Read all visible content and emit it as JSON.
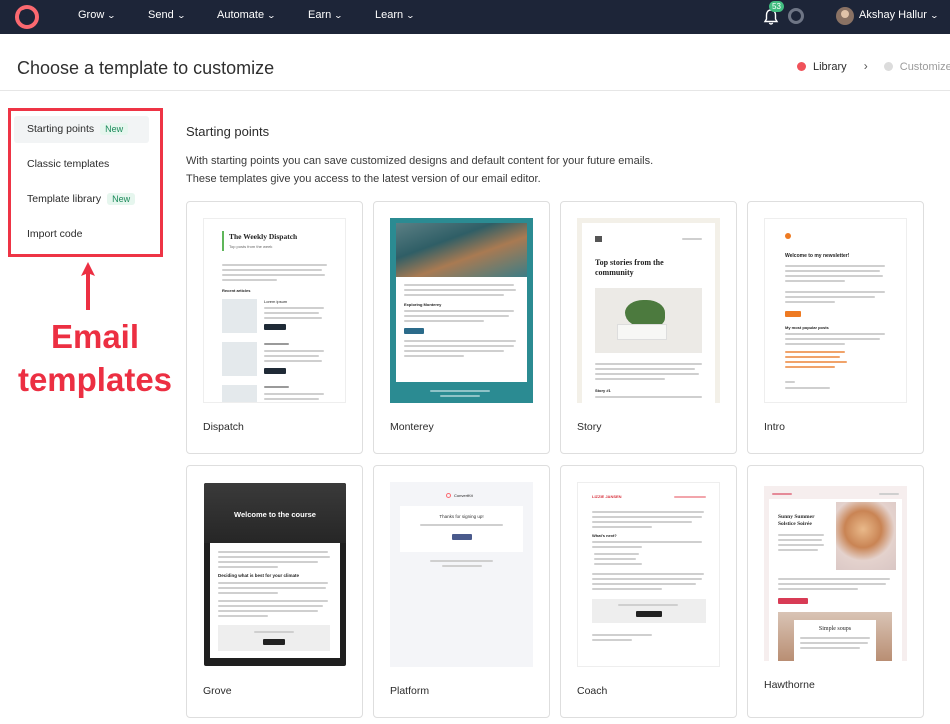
{
  "nav": {
    "items": [
      {
        "label": "Grow"
      },
      {
        "label": "Send"
      },
      {
        "label": "Automate"
      },
      {
        "label": "Earn"
      },
      {
        "label": "Learn"
      }
    ],
    "notification_count": "53",
    "user_name": "Akshay Hallur"
  },
  "header": {
    "title": "Choose a template to customize",
    "steps": [
      {
        "label": "Library",
        "state": "active",
        "color": "#f0525a"
      },
      {
        "label": "Customize",
        "state": "inactive",
        "color": "#d8d8d8"
      }
    ]
  },
  "sidebar": {
    "items": [
      {
        "label": "Starting points",
        "badge": "New",
        "active": true
      },
      {
        "label": "Classic templates",
        "badge": null,
        "active": false
      },
      {
        "label": "Template library",
        "badge": "New",
        "active": false
      },
      {
        "label": "Import code",
        "badge": null,
        "active": false
      }
    ],
    "annotation": {
      "line1": "Email",
      "line2": "templates",
      "color": "#ec2f42"
    }
  },
  "main": {
    "section_title": "Starting points",
    "description_line1": "With starting points you can save customized designs and default content for your future emails.",
    "description_line2": "These templates give you access to the latest version of our email editor."
  },
  "templates": [
    {
      "name": "Dispatch",
      "preview": {
        "heading": "The Weekly Dispatch",
        "subheading": "Top posts from the week",
        "section": "Recent articles",
        "item_title": "Lorem ipsum",
        "button": "Read article",
        "accent": "#5fb65a"
      }
    },
    {
      "name": "Monterey",
      "preview": {
        "heading": "Exploring Monterey",
        "button": "Click here",
        "accent": "#2b8b92"
      }
    },
    {
      "name": "Story",
      "preview": {
        "heading": "Top stories from the community",
        "subheading": "Story #1"
      }
    },
    {
      "name": "Intro",
      "preview": {
        "heading": "Welcome to my newsletter!",
        "subheading": "My most popular posts",
        "accent": "#ee7a22"
      }
    },
    {
      "name": "Grove",
      "preview": {
        "heading": "Welcome to the course",
        "subheading": "Deciding what is best for your climate",
        "button": "Sign up"
      }
    },
    {
      "name": "Platform",
      "preview": {
        "brand": "ConvertKit",
        "heading": "Thanks for signing up!",
        "button": "Click here",
        "accent": "#4a5a8c"
      }
    },
    {
      "name": "Coach",
      "preview": {
        "brand": "LIZZIE JANSEN",
        "subheading": "What's next?",
        "accent": "#d8343f"
      }
    },
    {
      "name": "Hawthorne",
      "preview": {
        "heading": "Sunny Summer Solstice Soirée",
        "subheading": "Simple soups",
        "accent": "#d83b55"
      }
    }
  ]
}
